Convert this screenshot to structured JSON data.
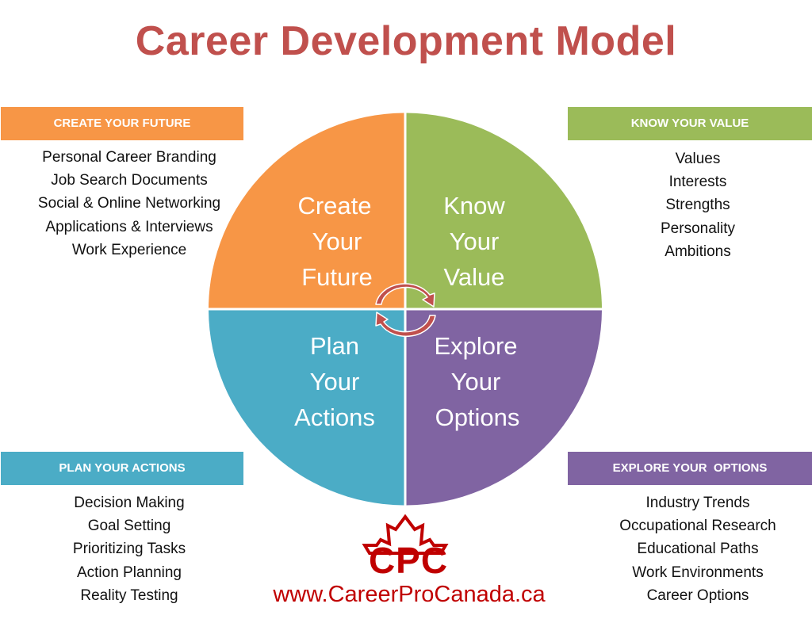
{
  "title": "Career Development Model",
  "colors": {
    "title": "#c0504d",
    "create": "#f79646",
    "know": "#9bbb59",
    "plan": "#4bacc6",
    "explore": "#8064a2",
    "arrow": "#c0504d",
    "brand": "#c00000"
  },
  "wheel": {
    "create": [
      "Create",
      "Your",
      "Future"
    ],
    "know": [
      "Know",
      "Your",
      "Value"
    ],
    "plan": [
      "Plan",
      "Your",
      "Actions"
    ],
    "explore": [
      "Explore",
      "Your",
      "Options"
    ]
  },
  "panels": {
    "create": {
      "header": "CREATE YOUR FUTURE",
      "items": [
        "Personal Career Branding",
        "Job Search Documents",
        "Social & Online Networking",
        "Applications & Interviews",
        "Work Experience"
      ]
    },
    "know": {
      "header": "KNOW YOUR VALUE",
      "items": [
        "Values",
        "Interests",
        "Strengths",
        "Personality",
        "Ambitions"
      ]
    },
    "plan": {
      "header": "PLAN YOUR ACTIONS",
      "items": [
        "Decision Making",
        "Goal Setting",
        "Prioritizing Tasks",
        "Action Planning",
        "Reality Testing"
      ]
    },
    "explore": {
      "header": "EXPLORE YOUR  OPTIONS",
      "items": [
        "Industry Trends",
        "Occupational Research",
        "Educational Paths",
        "Work Environments",
        "Career Options"
      ]
    }
  },
  "brand": {
    "logo_text": "CPC",
    "url": "www.CareerProCanada.ca"
  }
}
